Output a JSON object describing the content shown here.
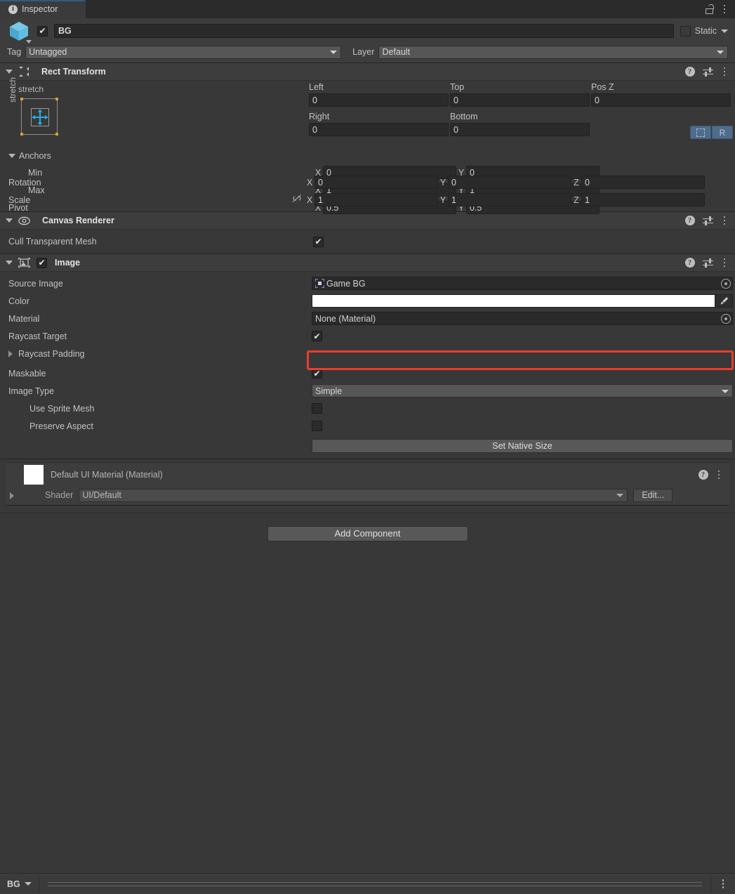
{
  "window": {
    "tab_label": "Inspector",
    "tab_icon": "info-icon",
    "lock_icon": "lock-open-icon",
    "menu_icon": "kebab-menu-icon"
  },
  "object_header": {
    "enabled_checkmark": "✔",
    "name_value": "BG",
    "static_label": "Static",
    "static_checked": false,
    "tag_label": "Tag",
    "tag_value": "Untagged",
    "layer_label": "Layer",
    "layer_value": "Default"
  },
  "rect_transform": {
    "title": "Rect Transform",
    "anchor_preset": {
      "top_label": "stretch",
      "side_label": "stretch"
    },
    "fields": {
      "left_label": "Left",
      "left_value": "0",
      "top_label": "Top",
      "top_value": "0",
      "posz_label": "Pos Z",
      "posz_value": "0",
      "right_label": "Right",
      "right_value": "0",
      "bottom_label": "Bottom",
      "bottom_value": "0"
    },
    "blueprint_button": "blueprint-mode-icon",
    "raw_button": "R",
    "anchors_label": "Anchors",
    "min_label": "Min",
    "min_x": "0",
    "min_y": "0",
    "max_label": "Max",
    "max_x": "1",
    "max_y": "1",
    "pivot_label": "Pivot",
    "pivot_x": "0.5",
    "pivot_y": "0.5",
    "rotation_label": "Rotation",
    "rotation_x": "0",
    "rotation_y": "0",
    "rotation_z": "0",
    "scale_label": "Scale",
    "scale_x": "1",
    "scale_y": "1",
    "scale_z": "1",
    "axis_x": "X",
    "axis_y": "Y",
    "axis_z": "Z"
  },
  "canvas_renderer": {
    "title": "Canvas Renderer",
    "cull_label": "Cull Transparent Mesh",
    "cull_checked": true,
    "checkmark": "✔"
  },
  "image": {
    "title": "Image",
    "enabled_checkmark": "✔",
    "source_image_label": "Source Image",
    "source_image_value": "Game BG",
    "color_label": "Color",
    "color_value": "#FFFFFF",
    "material_label": "Material",
    "material_value": "None (Material)",
    "raycast_target_label": "Raycast Target",
    "raycast_target_checked": true,
    "raycast_padding_label": "Raycast Padding",
    "maskable_label": "Maskable",
    "maskable_checked": true,
    "image_type_label": "Image Type",
    "image_type_value": "Simple",
    "use_sprite_mesh_label": "Use Sprite Mesh",
    "use_sprite_mesh_checked": false,
    "preserve_aspect_label": "Preserve Aspect",
    "preserve_aspect_checked": false,
    "set_native_size_label": "Set Native Size",
    "checkmark": "✔"
  },
  "material_panel": {
    "title": "Default UI Material (Material)",
    "shader_label": "Shader",
    "shader_value": "UI/Default",
    "edit_label": "Edit..."
  },
  "add_component_label": "Add Component",
  "bottom_bar": {
    "breadcrumb": "BG",
    "menu_icon": "kebab-menu-icon"
  },
  "highlight": {
    "color": "#ef3b2d",
    "target": "source-image-field"
  }
}
